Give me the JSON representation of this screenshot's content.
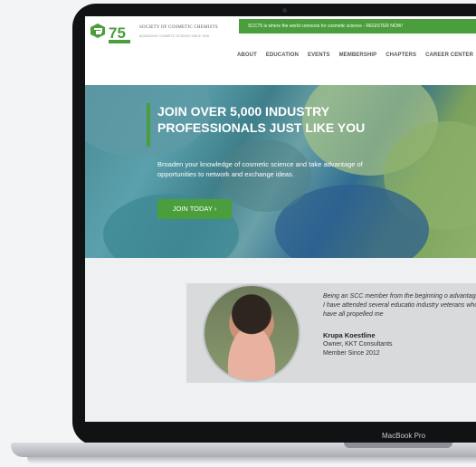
{
  "header": {
    "logo_number": "75",
    "logo_text": "SOCIETY OF COSMETIC CHEMISTS",
    "logo_tagline": "ADVANCING COSMETIC SCIENCE SINCE 1945",
    "banner": "SCC75 is where the world connects for cosmetic science - REGISTER NOW!",
    "nav": [
      "ABOUT",
      "EDUCATION",
      "EVENTS",
      "MEMBERSHIP",
      "CHAPTERS",
      "CAREER CENTER"
    ]
  },
  "hero": {
    "title": "JOIN OVER 5,000 INDUSTRY PROFESSIONALS JUST LIKE YOU",
    "body": "Broaden your knowledge of cosmetic science and take advantage of opportunities to network and exchange ideas.",
    "cta": "JOIN TODAY ›"
  },
  "testimonial": {
    "quote": "Being an SCC member from the beginning o advantage. I have attended several educatio industry veterans who have all propelled me",
    "name": "Krupa Koestline",
    "role": "Owner, KKT Consultants",
    "since": "Member Since 2012"
  },
  "device_label": "MacBook Pro",
  "colors": {
    "brand_green": "#4a9e3b",
    "bezel": "#111214"
  }
}
